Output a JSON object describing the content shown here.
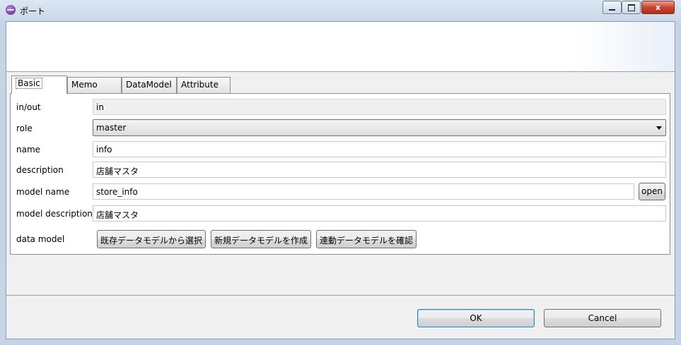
{
  "window": {
    "title": "ポート",
    "close_glyph": "x"
  },
  "tabs": [
    {
      "label": "Basic"
    },
    {
      "label": "Memo"
    },
    {
      "label": "DataModel"
    },
    {
      "label": "Attribute"
    }
  ],
  "basic": {
    "inout": {
      "label": "in/out",
      "value": "in"
    },
    "role": {
      "label": "role",
      "value": "master"
    },
    "name": {
      "label": "name",
      "value": "info"
    },
    "description": {
      "label": "description",
      "value": "店舗マスタ"
    },
    "model_name": {
      "label": "model name",
      "value": "store_info",
      "open_label": "open"
    },
    "model_description": {
      "label": "model description",
      "value": "店舗マスタ"
    },
    "data_model": {
      "label": "data model",
      "select_existing": "既存データモデルから選択",
      "create_new": "新規データモデルを作成",
      "check_linked": "連動データモデルを確認"
    }
  },
  "footer": {
    "ok": "OK",
    "cancel": "Cancel"
  }
}
